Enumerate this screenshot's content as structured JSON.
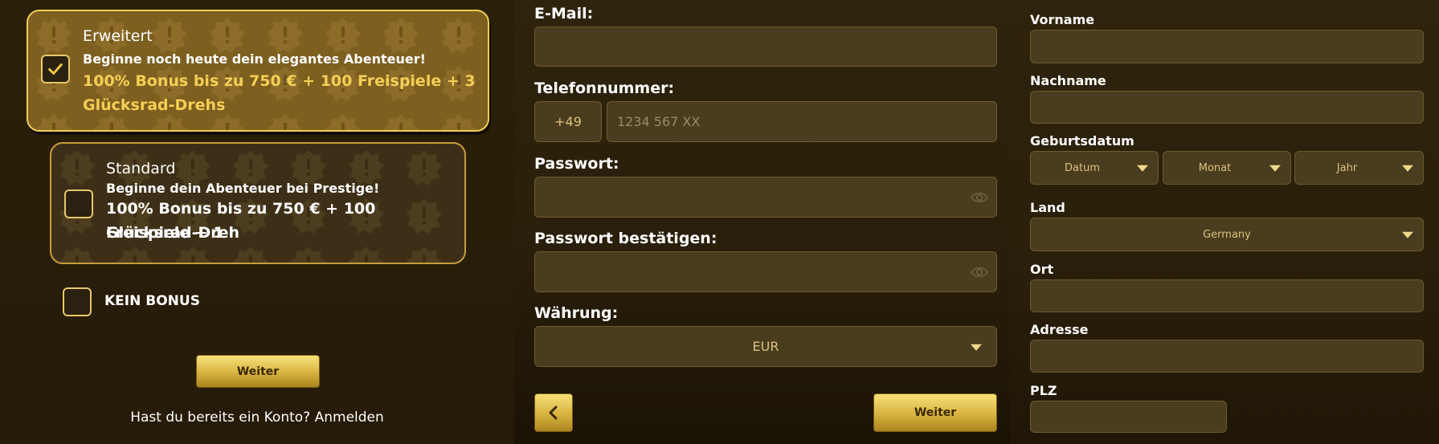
{
  "bonus_options": [
    {
      "title": "Erweitert",
      "subtitle": "Beginne noch heute dein elegantes Abenteuer!",
      "bonus_line1": "100% Bonus bis zu 750 € + 100 Freispiele + 3",
      "bonus_line2": "Glücksrad-Drehs",
      "checked": true
    },
    {
      "title": "Standard",
      "subtitle": "Beginne dein Abenteuer bei Prestige!",
      "bonus_line1": "100% Bonus bis zu 750 € + 100 Freispiele + 1",
      "bonus_line2": "Glücksrad-Dreh",
      "checked": false
    }
  ],
  "no_bonus_label": "KEIN BONUS",
  "step1": {
    "next_button": "Weiter",
    "login_prompt": "Hast du bereits ein Konto? Anmelden"
  },
  "step2": {
    "email_label": "E-Mail:",
    "email_value": "",
    "phone_label": "Telefonnummer:",
    "phone_prefix": "+49",
    "phone_placeholder": "1234 567 XX",
    "password_label": "Passwort:",
    "password_confirm_label": "Passwort bestätigen:",
    "currency_label": "Währung:",
    "currency_value": "EUR",
    "next_button": "Weiter"
  },
  "step3": {
    "firstname_label": "Vorname",
    "lastname_label": "Nachname",
    "birthdate_label": "Geburtsdatum",
    "day_placeholder": "Datum",
    "month_placeholder": "Monat",
    "year_placeholder": "Jahr",
    "country_label": "Land",
    "country_value": "Germany",
    "city_label": "Ort",
    "address_label": "Adresse",
    "zip_label": "PLZ"
  },
  "colors": {
    "gold_accent": "#f0c64a",
    "background": "#2a1f09",
    "field_bg": "#4a3c1e"
  }
}
